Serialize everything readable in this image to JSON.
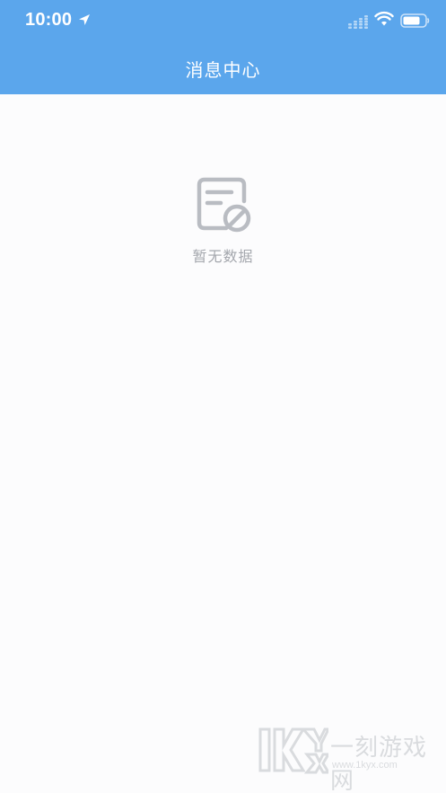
{
  "status_bar": {
    "time": "10:00",
    "icons": [
      "location-arrow-icon",
      "cellular-signal-icon",
      "wifi-icon",
      "battery-icon"
    ]
  },
  "nav": {
    "title": "消息中心"
  },
  "empty_state": {
    "icon": "document-no-data-icon",
    "text": "暂无数据"
  },
  "watermark": {
    "logo_text": "1KYX",
    "name": "一刻游戏网",
    "url": "www.1kyx.com"
  },
  "colors": {
    "header": "#5ba6ec",
    "background": "#fcfcfd",
    "empty_text": "#a4a7ad",
    "empty_icon": "#b9bcc2"
  }
}
